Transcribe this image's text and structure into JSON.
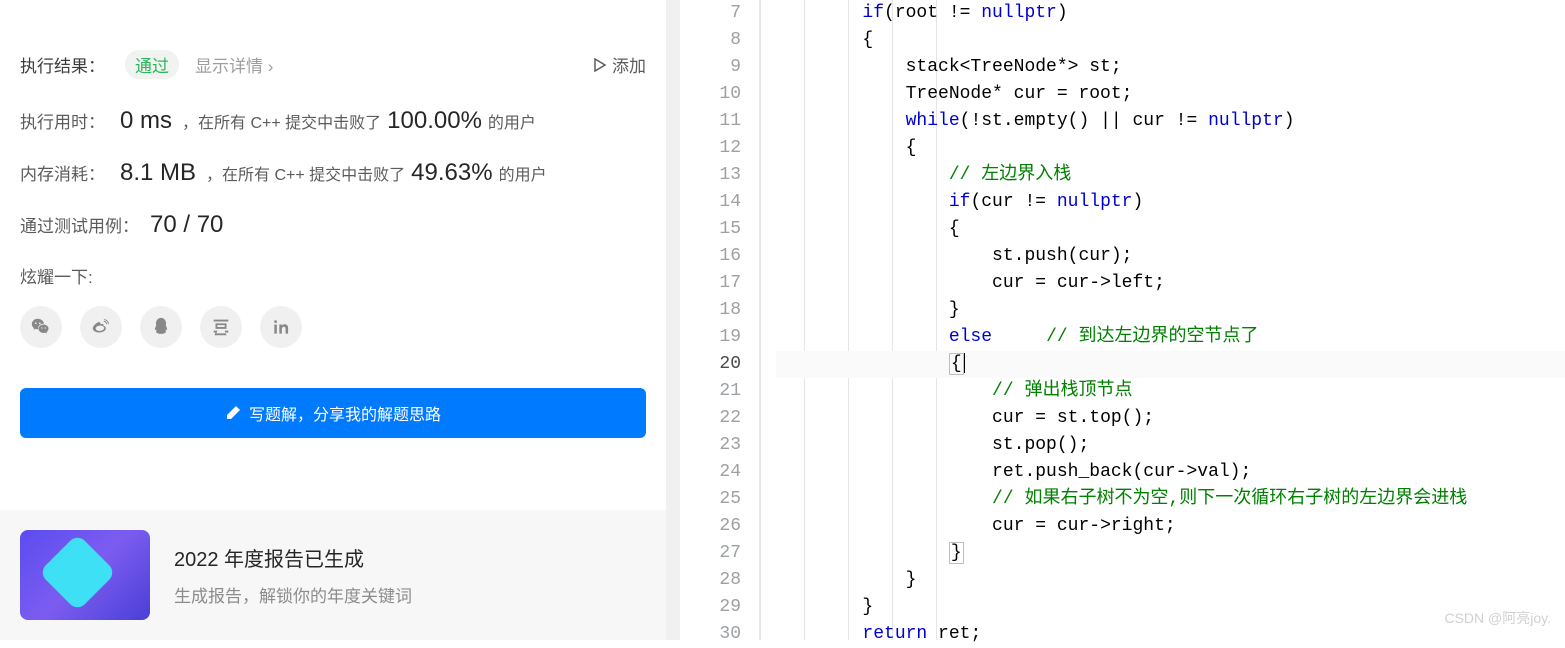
{
  "result": {
    "label": "执行结果：",
    "status": "通过",
    "show_detail": "显示详情 ›",
    "add_note": "添加"
  },
  "stats": {
    "time_label": "执行用时：",
    "time_value": "0 ms",
    "time_text1": "，在所有 C++ 提交中击败了",
    "time_percent": "100.00%",
    "time_text2": " 的用户",
    "mem_label": "内存消耗：",
    "mem_value": "8.1 MB",
    "mem_text1": "，在所有 C++ 提交中击败了",
    "mem_percent": "49.63%",
    "mem_text2": " 的用户",
    "cases_label": "通过测试用例：",
    "cases_value": "70 / 70"
  },
  "share": {
    "label": "炫耀一下:"
  },
  "button": {
    "write_solution": "写题解，分享我的解题思路"
  },
  "report": {
    "title": "2022 年度报告已生成",
    "subtitle": "生成报告，解锁你的年度关键词"
  },
  "code": {
    "lines": [
      {
        "n": 7,
        "indent": 2,
        "segs": [
          {
            "c": "kw",
            "t": "if"
          },
          {
            "t": "(root != "
          },
          {
            "c": "kw",
            "t": "nullptr"
          },
          {
            "t": ")"
          }
        ]
      },
      {
        "n": 8,
        "indent": 2,
        "segs": [
          {
            "t": "{"
          }
        ]
      },
      {
        "n": 9,
        "indent": 3,
        "segs": [
          {
            "t": "stack<TreeNode*> st;"
          }
        ]
      },
      {
        "n": 10,
        "indent": 3,
        "segs": [
          {
            "t": "TreeNode* cur = root;"
          }
        ]
      },
      {
        "n": 11,
        "indent": 3,
        "segs": [
          {
            "c": "kw",
            "t": "while"
          },
          {
            "t": "(!st.empty() || cur != "
          },
          {
            "c": "kw",
            "t": "nullptr"
          },
          {
            "t": ")"
          }
        ]
      },
      {
        "n": 12,
        "indent": 3,
        "segs": [
          {
            "t": "{"
          }
        ]
      },
      {
        "n": 13,
        "indent": 4,
        "segs": [
          {
            "c": "cm",
            "t": "// 左边界入栈"
          }
        ]
      },
      {
        "n": 14,
        "indent": 4,
        "segs": [
          {
            "c": "kw",
            "t": "if"
          },
          {
            "t": "(cur != "
          },
          {
            "c": "kw",
            "t": "nullptr"
          },
          {
            "t": ")"
          }
        ]
      },
      {
        "n": 15,
        "indent": 4,
        "segs": [
          {
            "t": "{"
          }
        ]
      },
      {
        "n": 16,
        "indent": 5,
        "segs": [
          {
            "t": "st.push(cur);"
          }
        ]
      },
      {
        "n": 17,
        "indent": 5,
        "segs": [
          {
            "t": "cur = cur->left;"
          }
        ]
      },
      {
        "n": 18,
        "indent": 4,
        "segs": [
          {
            "t": "}"
          }
        ]
      },
      {
        "n": 19,
        "indent": 4,
        "segs": [
          {
            "c": "kw",
            "t": "else"
          },
          {
            "t": "     "
          },
          {
            "c": "cm",
            "t": "// 到达左边界的空节点了"
          }
        ]
      },
      {
        "n": 20,
        "indent": 4,
        "current": true,
        "segs": [
          {
            "c": "bracket-box",
            "t": "{"
          },
          {
            "cursor": true
          }
        ]
      },
      {
        "n": 21,
        "indent": 5,
        "segs": [
          {
            "c": "cm",
            "t": "// 弹出栈顶节点"
          }
        ]
      },
      {
        "n": 22,
        "indent": 5,
        "segs": [
          {
            "t": "cur = st.top();"
          }
        ]
      },
      {
        "n": 23,
        "indent": 5,
        "segs": [
          {
            "t": "st.pop();"
          }
        ]
      },
      {
        "n": 24,
        "indent": 5,
        "segs": [
          {
            "t": "ret.push_back(cur->val);"
          }
        ]
      },
      {
        "n": 25,
        "indent": 5,
        "segs": [
          {
            "c": "cm",
            "t": "// 如果右子树不为空,则下一次循环右子树的左边界会进栈"
          }
        ]
      },
      {
        "n": 26,
        "indent": 5,
        "segs": [
          {
            "t": "cur = cur->right;"
          }
        ]
      },
      {
        "n": 27,
        "indent": 4,
        "segs": [
          {
            "c": "bracket-box",
            "t": "}"
          }
        ]
      },
      {
        "n": 28,
        "indent": 3,
        "segs": [
          {
            "t": "}"
          }
        ]
      },
      {
        "n": 29,
        "indent": 2,
        "segs": [
          {
            "t": "}"
          }
        ]
      },
      {
        "n": 30,
        "indent": 2,
        "segs": [
          {
            "c": "kw",
            "t": "return"
          },
          {
            "t": " ret;"
          }
        ]
      }
    ]
  },
  "watermark": "CSDN @阿亮joy."
}
